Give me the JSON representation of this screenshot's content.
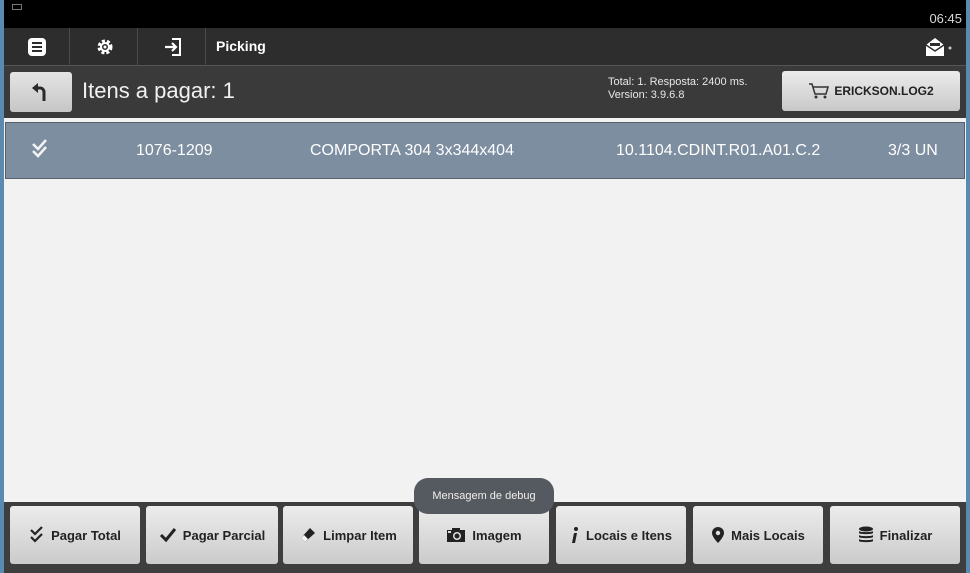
{
  "statusbar": {
    "time": "06:45"
  },
  "toolbar": {
    "title": "Picking"
  },
  "header": {
    "title": "Itens a pagar: 1",
    "info_line1": "Total: 1. Resposta: 2400 ms.",
    "info_line2": "Version: 3.9.6.8",
    "user": "ERICKSON.LOG2"
  },
  "items": [
    {
      "code": "1076-1209",
      "description": "COMPORTA 304 3x344x404",
      "location": "10.1104.CDINT.R01.A01.C.2",
      "quantity": "3/3 UN"
    }
  ],
  "toast": "Mensagem de debug",
  "buttons": {
    "pagar_total": "Pagar Total",
    "pagar_parcial": "Pagar Parcial",
    "limpar_item": "Limpar Item",
    "imagem": "Imagem",
    "locais_itens": "Locais e Itens",
    "mais_locais": "Mais Locais",
    "finalizar": "Finalizar"
  }
}
